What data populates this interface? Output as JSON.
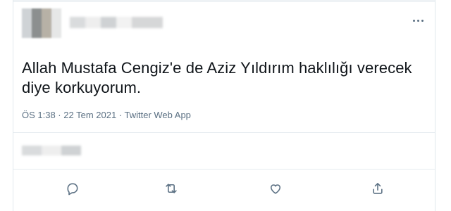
{
  "tweet": {
    "text": "Allah Mustafa Cengiz'e de Aziz Yıldırım haklılığı verecek\ndiye korkuyorum.",
    "meta": "ÖS 1:38 · 22 Tem 2021 · Twitter Web App"
  },
  "icons": {
    "more": "more-icon",
    "reply": "reply-icon",
    "retweet": "retweet-icon",
    "like": "like-icon",
    "share": "share-icon"
  },
  "colors": {
    "text": "#0f1419",
    "secondary": "#5b7083",
    "border": "#e6ecf0"
  }
}
